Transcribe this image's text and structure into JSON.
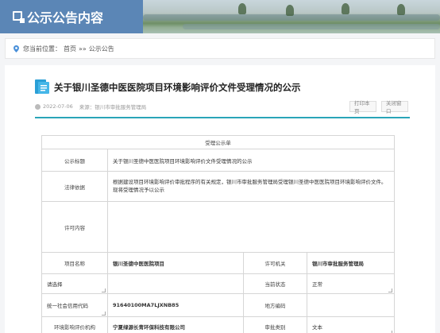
{
  "banner": {
    "title": "公示公告内容"
  },
  "breadcrumb": {
    "prefix": "您当前位置：",
    "home": "首页",
    "separator": "»»",
    "current": "公示公告"
  },
  "article": {
    "title": "关于银川圣德中医医院项目环境影响评价文件受理情况的公示",
    "date": "2022-07-06",
    "source": "来源：银川市审批服务管理局",
    "print_label": "打印本页",
    "close_label": "关闭窗口"
  },
  "table": {
    "header": "受理公示单",
    "rows": {
      "title_label": "公示标题",
      "title_value": "关于银川圣德中医医院项目环境影响评价文件受理情况的公示",
      "basis_label": "法律依据",
      "basis_value": "根据建设项目环境影响评价审批程序的有关规定，银川市审批服务管理局受理银川圣德中医医院项目环境影响评价文件。 现将受理情况予以公示",
      "content_label": "许可内容",
      "content_value": "",
      "project_label": "项目名称",
      "project_value": "银川圣德中医医院项目",
      "authority_label": "许可机关",
      "authority_value": "银川市审批服务管理局",
      "select1": "请选择",
      "status_label": "当前状态",
      "status_value": "正常",
      "credit_label": "统一社会信用代码",
      "credit_value": "91640100MA7LJXNB85",
      "region_label": "地方编码",
      "region_value": "",
      "eia_label": "环境影响评价机构",
      "eia_value": "宁夏绿源长青环保科技有限公司",
      "type_label": "审批类别",
      "type_value": "文本"
    }
  },
  "colors": {
    "banner_blue": "#5b86b6",
    "divider": "#2aa5b8"
  }
}
